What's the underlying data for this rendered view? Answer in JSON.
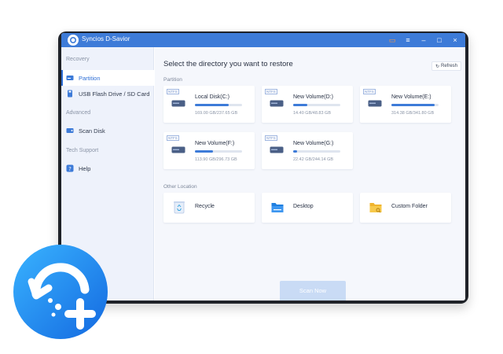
{
  "app": {
    "title": "Syncios D-Savior"
  },
  "colors": {
    "accent": "#3d7bd8",
    "sidebar_bg": "#eef2fb",
    "main_bg": "#f5f7fc",
    "scan_disabled": "#c9dbf5"
  },
  "sidebar": {
    "sections": [
      {
        "label": "Recovery",
        "items": [
          {
            "label": "Partition",
            "icon": "partition-icon",
            "active": true
          },
          {
            "label": "USB Flash Drive / SD Card",
            "icon": "usb-icon",
            "active": false
          }
        ]
      },
      {
        "label": "Advanced",
        "items": [
          {
            "label": "Scan Disk",
            "icon": "disk-icon",
            "active": false
          }
        ]
      },
      {
        "label": "Tech Support",
        "items": [
          {
            "label": "Help",
            "icon": "help-icon",
            "active": false
          }
        ]
      }
    ]
  },
  "main": {
    "heading": "Select the directory you want to restore",
    "refresh_label": "Refresh",
    "partition_label": "Partition",
    "partitions": [
      {
        "fs": "NTFS",
        "name": "Local Disk(C:)",
        "size": "169.00 GB/237.65 GB",
        "used": 0.71
      },
      {
        "fs": "NTFS",
        "name": "New Volume(D:)",
        "size": "14.40 GB/48.83 GB",
        "used": 0.3
      },
      {
        "fs": "NTFS",
        "name": "New Volume(E:)",
        "size": "314.38 GB/341.80 GB",
        "used": 0.92
      },
      {
        "fs": "NTFS",
        "name": "New Volume(F:)",
        "size": "113.90 GB/296.73 GB",
        "used": 0.38
      },
      {
        "fs": "NTFS",
        "name": "New Volume(G:)",
        "size": "22.42 GB/244.14 GB",
        "used": 0.09
      }
    ],
    "other_label": "Other Location",
    "locations": [
      {
        "name": "Recycle",
        "icon": "recycle-bin-icon"
      },
      {
        "name": "Desktop",
        "icon": "desktop-folder-icon"
      },
      {
        "name": "Custom Folder",
        "icon": "custom-folder-icon"
      }
    ],
    "scan_button": "Scan Now"
  }
}
